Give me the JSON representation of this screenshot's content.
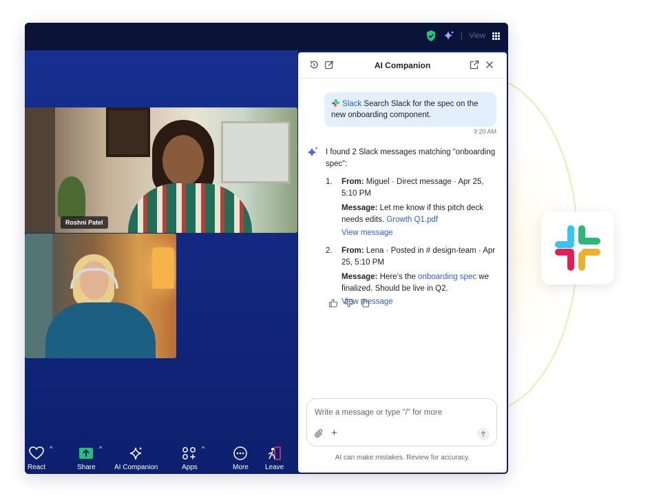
{
  "app": {
    "view_label": "View"
  },
  "participants": [
    {
      "name": "Roshni Patel"
    },
    {
      "name": ""
    }
  ],
  "toolbar": {
    "react": "React",
    "share": "Share",
    "ai_companion": "AI Companion",
    "apps": "Apps",
    "more": "More",
    "leave": "Leave"
  },
  "ai_panel": {
    "title": "AI Companion",
    "user_message": {
      "app": "Slack",
      "text": "Search Slack for the spec on the new onboarding component.",
      "time": "9:20 AM"
    },
    "reply": {
      "intro": "I found 2 Slack messages matching “onboarding spec”:",
      "results": [
        {
          "num": "1.",
          "from_label": "From:",
          "from": "Miguel · Direct message · Apr 25, 5:10 PM",
          "message_label": "Message:",
          "message_before": "Let me know if this pitch deck needs edits.",
          "message_link": "Growth Q1.pdf",
          "message_after": "",
          "view_link": "View message"
        },
        {
          "num": "2.",
          "from_label": "From:",
          "from": "Lena · Posted in # design-team · Apr 25, 5:10 PM",
          "message_label": "Message:",
          "message_before": "Here’s the",
          "message_link": "onboarding spec",
          "message_after": "we finalized. Should be live in Q2.",
          "view_link": "View message"
        }
      ]
    },
    "composer": {
      "placeholder": "Write a message or type \"/\"  for more",
      "plus": "+"
    },
    "disclaimer": "AI can make mistakes. Review for accuracy."
  },
  "colors": {
    "stage": "#17308f",
    "link": "#2f63c5",
    "bubble": "#e4effd",
    "slack_blue": "#36c5f0",
    "slack_green": "#2eb67d",
    "slack_yellow": "#ecb22e",
    "slack_red": "#e01e5a"
  },
  "icons": {
    "history": "history-icon",
    "compose": "compose-icon",
    "popout": "popout-icon",
    "close": "close-icon",
    "shield": "shield-check-icon",
    "sparkle": "sparkle-icon",
    "grid": "grid-view-icon"
  }
}
